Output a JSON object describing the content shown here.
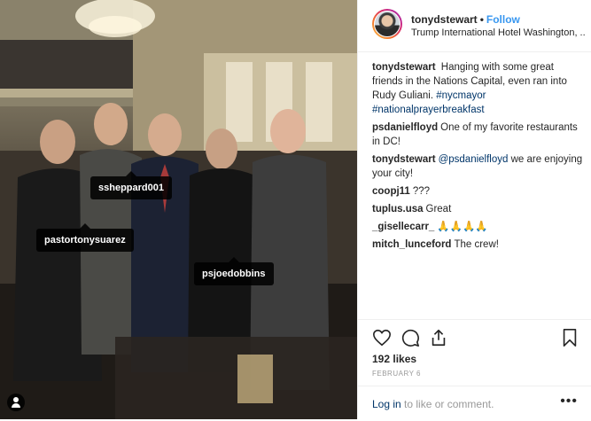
{
  "post": {
    "photo_tags": [
      {
        "label": "ssheppard001"
      },
      {
        "label": "pastortonysuarez"
      },
      {
        "label": "psjoedobbins"
      }
    ]
  },
  "header": {
    "username": "tonydstewart",
    "dot": "•",
    "follow_label": "Follow",
    "location": "Trump International Hotel Washington, ..."
  },
  "caption": {
    "username": "tonydstewart",
    "text": "Hanging with some great friends in the Nations Capital, even ran into Rudy Guliani.",
    "hashtags": [
      "#nycmayor",
      "#nationalprayerbreakfast"
    ]
  },
  "comments": [
    {
      "username": "psdanielfloyd",
      "text": "One of my favorite restaurants in DC!"
    },
    {
      "username": "tonydstewart",
      "mention": "@psdanielfloyd",
      "text": "we are enjoying your city!"
    },
    {
      "username": "coopj11",
      "text": "???"
    },
    {
      "username": "tuplus.usa",
      "text": "Great"
    },
    {
      "username": "_gisellecarr_",
      "text": "🙏🙏🙏🙏"
    },
    {
      "username": "mitch_lunceford",
      "text": "The crew!"
    }
  ],
  "actions": {
    "likes": "192 likes",
    "date": "FEBRUARY 6",
    "icons": [
      "heart-icon",
      "comment-icon",
      "share-icon",
      "bookmark-icon"
    ]
  },
  "login": {
    "link_text": "Log in",
    "rest_text": "to like or comment.",
    "more": "•••"
  },
  "colors": {
    "link_blue": "#3897f0",
    "hashtag": "#003569",
    "muted": "#999999"
  }
}
